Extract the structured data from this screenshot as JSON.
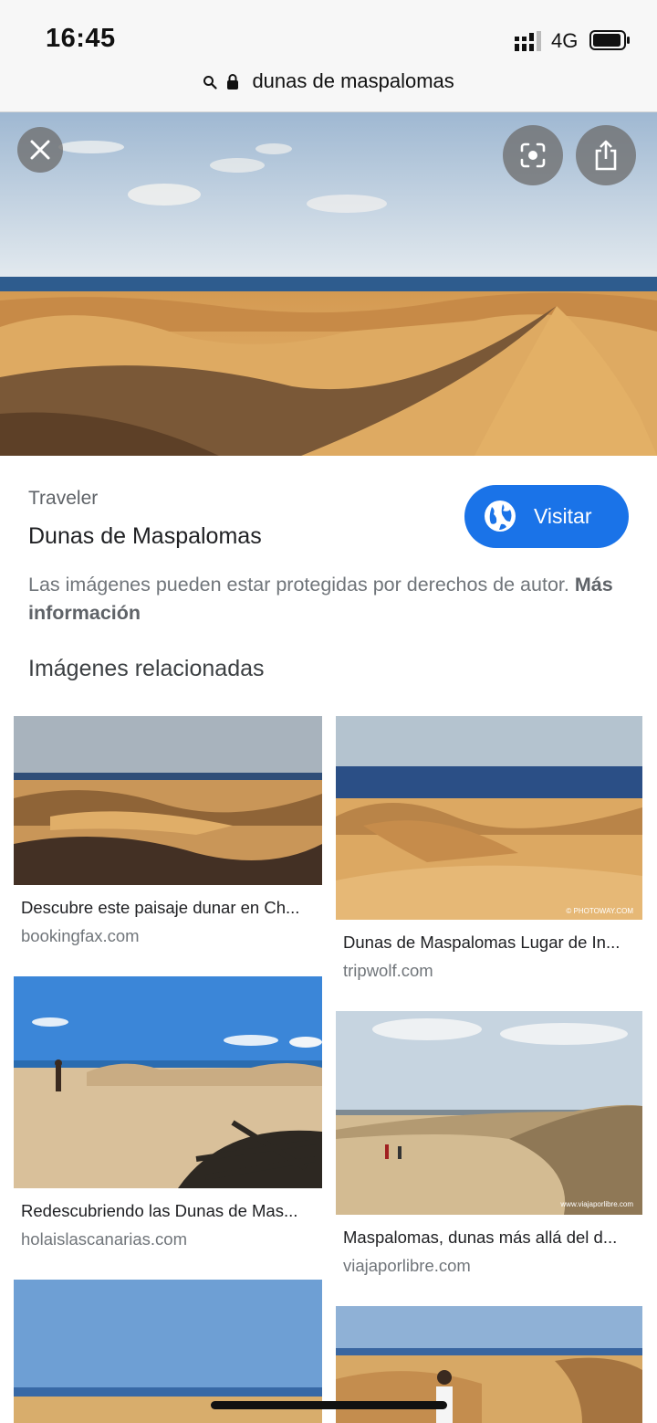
{
  "status": {
    "time": "16:45",
    "network": "4G"
  },
  "url_bar": {
    "query": "dunas de maspalomas"
  },
  "hero": {
    "close_icon": "close-icon",
    "lens_icon": "lens-icon",
    "share_icon": "share-icon"
  },
  "info": {
    "source": "Traveler",
    "title": "Dunas de Maspalomas",
    "visit_label": "Visitar",
    "copyright_text": "Las imágenes pueden estar protegidas por derechos de autor.",
    "more_info": "Más información"
  },
  "related": {
    "heading": "Imágenes relacionadas",
    "items": [
      {
        "caption": "Descubre este paisaje dunar en Ch...",
        "site": "bookingfax.com"
      },
      {
        "caption": "Dunas de Maspalomas Lugar de In...",
        "site": "tripwolf.com",
        "watermark": "© PHOTOWAY.COM"
      },
      {
        "caption": "Redescubriendo las Dunas de Mas...",
        "site": "holaislascanarias.com"
      },
      {
        "caption": "Maspalomas, dunas más allá del d...",
        "site": "viajaporlibre.com",
        "watermark": "www.viajaporlibre.com"
      }
    ]
  },
  "colors": {
    "accent": "#1a73e8",
    "sand": "#d9a55a",
    "sky": "#b9cde0",
    "sea": "#2b5a8c"
  }
}
